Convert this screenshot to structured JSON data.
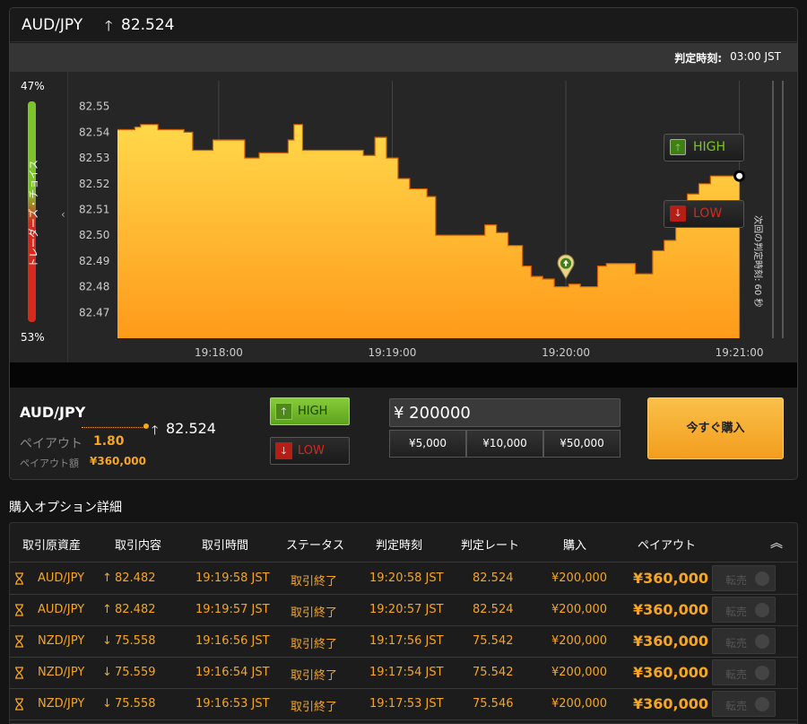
{
  "header": {
    "pair": "AUD/JPY",
    "direction_icon": "up-arrow-icon",
    "rate": "82.524"
  },
  "expiry": {
    "label": "判定時刻:",
    "value": "03:00 JST"
  },
  "sentiment": {
    "top_pct": "47%",
    "bottom_pct": "53%",
    "label": "トレーダーズ・チョイス",
    "high_fraction": 0.47,
    "high_color": "#7dc42a",
    "low_color": "#d62a1c"
  },
  "next_expiry_label": "次回の判定時刻: 60 秒",
  "chart_buttons": {
    "high": "HIGH",
    "low": "LOW"
  },
  "chart_data": {
    "type": "area",
    "y_ticks": [
      "82.55",
      "82.54",
      "82.53",
      "82.52",
      "82.51",
      "82.50",
      "82.49",
      "82.48",
      "82.47"
    ],
    "x_ticks": [
      "19:18:00",
      "19:19:00",
      "19:20:00",
      "19:21:00"
    ],
    "ylim": [
      82.46,
      82.56
    ],
    "xlim_seconds_range": [
      "19:17:25",
      "19:21:15"
    ],
    "x": [
      "19:17:25",
      "19:17:31",
      "19:17:33",
      "19:17:39",
      "19:17:48",
      "19:17:51",
      "19:17:58",
      "19:18:06",
      "19:18:09",
      "19:18:14",
      "19:18:24",
      "19:18:26",
      "19:18:29",
      "19:18:39",
      "19:18:50",
      "19:18:54",
      "19:18:58",
      "19:19:02",
      "19:19:06",
      "19:19:12",
      "19:19:15",
      "19:19:27",
      "19:19:32",
      "19:19:36",
      "19:19:40",
      "19:19:45",
      "19:19:48",
      "19:19:52",
      "19:19:56",
      "19:20:01",
      "19:20:05",
      "19:20:11",
      "19:20:14",
      "19:20:20",
      "19:20:24",
      "19:20:30",
      "19:20:34",
      "19:20:38",
      "19:20:42",
      "19:20:46",
      "19:20:50",
      "19:20:55",
      "19:21:00"
    ],
    "y": [
      82.541,
      82.542,
      82.543,
      82.541,
      82.54,
      82.533,
      82.537,
      82.537,
      82.53,
      82.532,
      82.537,
      82.543,
      82.533,
      82.533,
      82.531,
      82.538,
      82.53,
      82.522,
      82.518,
      82.515,
      82.5,
      82.5,
      82.504,
      82.501,
      82.496,
      82.488,
      82.484,
      82.483,
      82.48,
      82.481,
      82.48,
      82.488,
      82.489,
      82.489,
      82.485,
      82.494,
      82.498,
      82.508,
      82.516,
      82.52,
      82.523,
      82.523,
      82.523
    ],
    "entry_marker": {
      "x": "19:20:00",
      "y": 82.488,
      "direction": "high"
    },
    "fill_colors": [
      "#ffd84a",
      "#ff9a1a"
    ]
  },
  "order": {
    "pair": "AUD/JPY",
    "rate": "82.524",
    "payout_label": "ペイアウト",
    "payout_value": "1.80",
    "payout_amount_label": "ペイアウト額",
    "payout_amount_value": "¥360,000",
    "high_label": "HIGH",
    "low_label": "LOW",
    "amount": "¥ 200000",
    "chips": [
      "¥5,000",
      "¥10,000",
      "¥50,000"
    ],
    "buy_label": "今すぐ購入"
  },
  "details_title": "購入オプション詳細",
  "table": {
    "headers": [
      "取引原資産",
      "取引内容",
      "取引時間",
      "ステータス",
      "判定時刻",
      "判定レート",
      "購入",
      "ペイアウト"
    ],
    "resell_label": "転売",
    "rows": [
      {
        "asset": "AUD/JPY",
        "dir": "↑",
        "strike": "82.482",
        "time": "19:19:58 JST",
        "status": "取引終了",
        "expiry": "19:20:58 JST",
        "rate": "82.524",
        "buy": "¥200,000",
        "payout": "¥360,000"
      },
      {
        "asset": "AUD/JPY",
        "dir": "↑",
        "strike": "82.482",
        "time": "19:19:57 JST",
        "status": "取引終了",
        "expiry": "19:20:57 JST",
        "rate": "82.524",
        "buy": "¥200,000",
        "payout": "¥360,000"
      },
      {
        "asset": "NZD/JPY",
        "dir": "↓",
        "strike": "75.558",
        "time": "19:16:56 JST",
        "status": "取引終了",
        "expiry": "19:17:56 JST",
        "rate": "75.542",
        "buy": "¥200,000",
        "payout": "¥360,000"
      },
      {
        "asset": "NZD/JPY",
        "dir": "↓",
        "strike": "75.559",
        "time": "19:16:54 JST",
        "status": "取引終了",
        "expiry": "19:17:54 JST",
        "rate": "75.542",
        "buy": "¥200,000",
        "payout": "¥360,000"
      },
      {
        "asset": "NZD/JPY",
        "dir": "↓",
        "strike": "75.558",
        "time": "19:16:53 JST",
        "status": "取引終了",
        "expiry": "19:17:53 JST",
        "rate": "75.546",
        "buy": "¥200,000",
        "payout": "¥360,000"
      }
    ]
  }
}
